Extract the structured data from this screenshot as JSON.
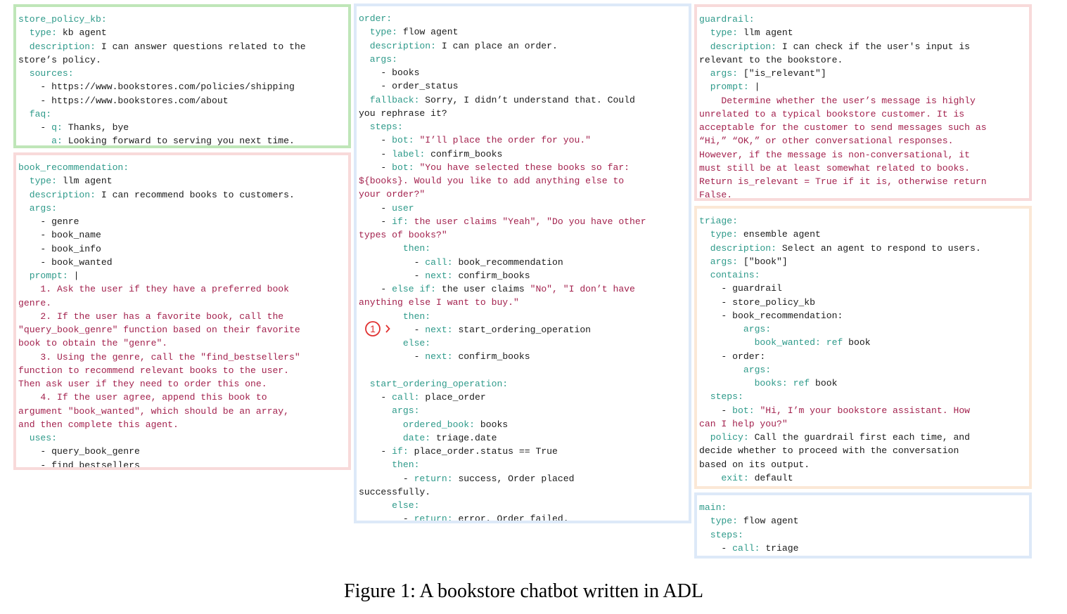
{
  "colors": {
    "key": "#2e9a8a",
    "string": "#a3224e",
    "text": "#1a1a1a",
    "green_border": "#bfe6b8",
    "red_border": "#f8dada",
    "blue_border": "#dde9f8",
    "orange_border": "#fbe8d6",
    "marker": "#e03030"
  },
  "marker_label": "1",
  "caption": "Figure 1: A bookstore chatbot written in ADL",
  "boxes": [
    {
      "name": "store-policy-kb",
      "lines": [
        [
          [
            "k",
            "store_policy_kb:"
          ]
        ],
        [
          [
            "k",
            "  type: "
          ],
          [
            "t",
            "kb agent"
          ]
        ],
        [
          [
            "k",
            "  description: "
          ],
          [
            "t",
            "I can answer questions related to the"
          ]
        ],
        [
          [
            "t",
            "store’s policy."
          ]
        ],
        [
          [
            "k",
            "  sources:"
          ]
        ],
        [
          [
            "t",
            "    - https://www.bookstores.com/policies/shipping"
          ]
        ],
        [
          [
            "t",
            "    - https://www.bookstores.com/about"
          ]
        ],
        [
          [
            "k",
            "  faq:"
          ]
        ],
        [
          [
            "t",
            "    - "
          ],
          [
            "k",
            "q: "
          ],
          [
            "t",
            "Thanks, bye"
          ]
        ],
        [
          [
            "k",
            "      a: "
          ],
          [
            "t",
            "Looking forward to serving you next time."
          ]
        ]
      ]
    },
    {
      "name": "book-recommendation",
      "lines": [
        [
          [
            "k",
            "book_recommendation:"
          ]
        ],
        [
          [
            "k",
            "  type: "
          ],
          [
            "t",
            "llm agent"
          ]
        ],
        [
          [
            "k",
            "  description: "
          ],
          [
            "t",
            "I can recommend books to customers."
          ]
        ],
        [
          [
            "k",
            "  args:"
          ]
        ],
        [
          [
            "t",
            "    - genre"
          ]
        ],
        [
          [
            "t",
            "    - book_name"
          ]
        ],
        [
          [
            "t",
            "    - book_info"
          ]
        ],
        [
          [
            "t",
            "    - book_wanted"
          ]
        ],
        [
          [
            "k",
            "  prompt: "
          ],
          [
            "t",
            "|"
          ]
        ],
        [
          [
            "s",
            "    1. Ask the user if they have a preferred book"
          ]
        ],
        [
          [
            "s",
            "genre."
          ]
        ],
        [
          [
            "s",
            "    2. If the user has a favorite book, call the"
          ]
        ],
        [
          [
            "s",
            "\"query_book_genre\" function based on their favorite"
          ]
        ],
        [
          [
            "s",
            "book to obtain the \"genre\"."
          ]
        ],
        [
          [
            "s",
            "    3. Using the genre, call the \"find_bestsellers\""
          ]
        ],
        [
          [
            "s",
            "function to recommend relevant books to the user."
          ]
        ],
        [
          [
            "s",
            "Then ask user if they need to order this one."
          ]
        ],
        [
          [
            "s",
            "    4. If the user agree, append this book to"
          ]
        ],
        [
          [
            "s",
            "argument \"book_wanted\", which should be an array,"
          ]
        ],
        [
          [
            "s",
            "and then complete this agent."
          ]
        ],
        [
          [
            "k",
            "  uses:"
          ]
        ],
        [
          [
            "t",
            "    - query_book_genre"
          ]
        ],
        [
          [
            "t",
            "    - find_bestsellers"
          ]
        ]
      ]
    },
    {
      "name": "order",
      "lines": [
        [
          [
            "k",
            "order:"
          ]
        ],
        [
          [
            "k",
            "  type: "
          ],
          [
            "t",
            "flow agent"
          ]
        ],
        [
          [
            "k",
            "  description: "
          ],
          [
            "t",
            "I can place an order."
          ]
        ],
        [
          [
            "k",
            "  args:"
          ]
        ],
        [
          [
            "t",
            "    - books"
          ]
        ],
        [
          [
            "t",
            "    - order_status"
          ]
        ],
        [
          [
            "k",
            "  fallback: "
          ],
          [
            "t",
            "Sorry, I didn’t understand that. Could"
          ]
        ],
        [
          [
            "t",
            "you rephrase it?"
          ]
        ],
        [
          [
            "k",
            "  steps:"
          ]
        ],
        [
          [
            "t",
            "    - "
          ],
          [
            "k",
            "bot: "
          ],
          [
            "s",
            "\"I’ll place the order for you.\""
          ]
        ],
        [
          [
            "t",
            "    - "
          ],
          [
            "k",
            "label: "
          ],
          [
            "t",
            "confirm_books"
          ]
        ],
        [
          [
            "t",
            "    - "
          ],
          [
            "k",
            "bot: "
          ],
          [
            "s",
            "\"You have selected these books so far:"
          ]
        ],
        [
          [
            "s",
            "${books}. Would you like to add anything else to"
          ]
        ],
        [
          [
            "s",
            "your order?\""
          ]
        ],
        [
          [
            "t",
            "    - "
          ],
          [
            "k",
            "user"
          ]
        ],
        [
          [
            "t",
            "    - "
          ],
          [
            "k",
            "if: "
          ],
          [
            "s",
            "the user claims \"Yeah\", \"Do you have other"
          ]
        ],
        [
          [
            "s",
            "types of books?\""
          ]
        ],
        [
          [
            "k",
            "        then:"
          ]
        ],
        [
          [
            "t",
            "          - "
          ],
          [
            "k",
            "call: "
          ],
          [
            "t",
            "book_recommendation"
          ]
        ],
        [
          [
            "t",
            "          - "
          ],
          [
            "k",
            "next: "
          ],
          [
            "t",
            "confirm_books"
          ]
        ],
        [
          [
            "t",
            "    - "
          ],
          [
            "k",
            "else if: "
          ],
          [
            "t",
            "the user claims "
          ],
          [
            "s",
            "\"No\", \"I don’t have"
          ]
        ],
        [
          [
            "s",
            "anything else I want to buy.\""
          ]
        ],
        [
          [
            "k",
            "        then:"
          ]
        ],
        [
          [
            "t",
            "          - "
          ],
          [
            "k",
            "next: "
          ],
          [
            "t",
            "start_ordering_operation"
          ]
        ],
        [
          [
            "k",
            "        else:"
          ]
        ],
        [
          [
            "t",
            "          - "
          ],
          [
            "k",
            "next: "
          ],
          [
            "t",
            "confirm_books"
          ]
        ],
        [
          [
            "t",
            ""
          ]
        ],
        [
          [
            "k",
            "  start_ordering_operation:"
          ]
        ],
        [
          [
            "t",
            "    - "
          ],
          [
            "k",
            "call: "
          ],
          [
            "t",
            "place_order"
          ]
        ],
        [
          [
            "k",
            "      args:"
          ]
        ],
        [
          [
            "k",
            "        ordered_book: "
          ],
          [
            "t",
            "books"
          ]
        ],
        [
          [
            "k",
            "        date: "
          ],
          [
            "t",
            "triage.date"
          ]
        ],
        [
          [
            "t",
            "    - "
          ],
          [
            "k",
            "if: "
          ],
          [
            "t",
            "place_order.status == True"
          ]
        ],
        [
          [
            "k",
            "      then:"
          ]
        ],
        [
          [
            "t",
            "        - "
          ],
          [
            "k",
            "return: "
          ],
          [
            "t",
            "success, Order placed"
          ]
        ],
        [
          [
            "t",
            "successfully."
          ]
        ],
        [
          [
            "k",
            "      else:"
          ]
        ],
        [
          [
            "t",
            "        - "
          ],
          [
            "k",
            "return: "
          ],
          [
            "t",
            "error, Order failed."
          ]
        ]
      ]
    },
    {
      "name": "guardrail",
      "lines": [
        [
          [
            "k",
            "guardrail:"
          ]
        ],
        [
          [
            "k",
            "  type: "
          ],
          [
            "t",
            "llm agent"
          ]
        ],
        [
          [
            "k",
            "  description: "
          ],
          [
            "t",
            "I can check if the user's input is"
          ]
        ],
        [
          [
            "t",
            "relevant to the bookstore."
          ]
        ],
        [
          [
            "k",
            "  args: "
          ],
          [
            "t",
            "[\"is_relevant\"]"
          ]
        ],
        [
          [
            "k",
            "  prompt: "
          ],
          [
            "t",
            "|"
          ]
        ],
        [
          [
            "s",
            "    Determine whether the user’s message is highly"
          ]
        ],
        [
          [
            "s",
            "unrelated to a typical bookstore customer. It is"
          ]
        ],
        [
          [
            "s",
            "acceptable for the customer to send messages such as"
          ]
        ],
        [
          [
            "s",
            "“Hi,” “OK,” or other conversational responses."
          ]
        ],
        [
          [
            "s",
            "However, if the message is non-conversational, it"
          ]
        ],
        [
          [
            "s",
            "must still be at least somewhat related to books."
          ]
        ],
        [
          [
            "s",
            "Return is_relevant = True if it is, otherwise return"
          ]
        ],
        [
          [
            "s",
            "False."
          ]
        ]
      ]
    },
    {
      "name": "triage",
      "lines": [
        [
          [
            "k",
            "triage:"
          ]
        ],
        [
          [
            "k",
            "  type: "
          ],
          [
            "t",
            "ensemble agent"
          ]
        ],
        [
          [
            "k",
            "  description: "
          ],
          [
            "t",
            "Select an agent to respond to users."
          ]
        ],
        [
          [
            "k",
            "  args: "
          ],
          [
            "t",
            "[\"book\"]"
          ]
        ],
        [
          [
            "k",
            "  contains:"
          ]
        ],
        [
          [
            "t",
            "    - guardrail"
          ]
        ],
        [
          [
            "t",
            "    - store_policy_kb"
          ]
        ],
        [
          [
            "t",
            "    - book_recommendation:"
          ]
        ],
        [
          [
            "k",
            "        args:"
          ]
        ],
        [
          [
            "k",
            "          book_wanted: ref "
          ],
          [
            "t",
            "book"
          ]
        ],
        [
          [
            "t",
            "    - order:"
          ]
        ],
        [
          [
            "k",
            "        args:"
          ]
        ],
        [
          [
            "k",
            "          books: ref "
          ],
          [
            "t",
            "book"
          ]
        ],
        [
          [
            "k",
            "  steps:"
          ]
        ],
        [
          [
            "t",
            "    - "
          ],
          [
            "k",
            "bot: "
          ],
          [
            "s",
            "\"Hi, I’m your bookstore assistant. How"
          ]
        ],
        [
          [
            "s",
            "can I help you?\""
          ]
        ],
        [
          [
            "k",
            "  policy: "
          ],
          [
            "t",
            "Call the guardrail first each time, and"
          ]
        ],
        [
          [
            "t",
            "decide whether to proceed with the conversation"
          ]
        ],
        [
          [
            "t",
            "based on its output."
          ]
        ],
        [
          [
            "k",
            "    exit: "
          ],
          [
            "t",
            "default"
          ]
        ]
      ]
    },
    {
      "name": "main",
      "lines": [
        [
          [
            "k",
            "main:"
          ]
        ],
        [
          [
            "k",
            "  type: "
          ],
          [
            "t",
            "flow agent"
          ]
        ],
        [
          [
            "k",
            "  steps:"
          ]
        ],
        [
          [
            "t",
            "    - "
          ],
          [
            "k",
            "call: "
          ],
          [
            "t",
            "triage"
          ]
        ]
      ]
    }
  ]
}
